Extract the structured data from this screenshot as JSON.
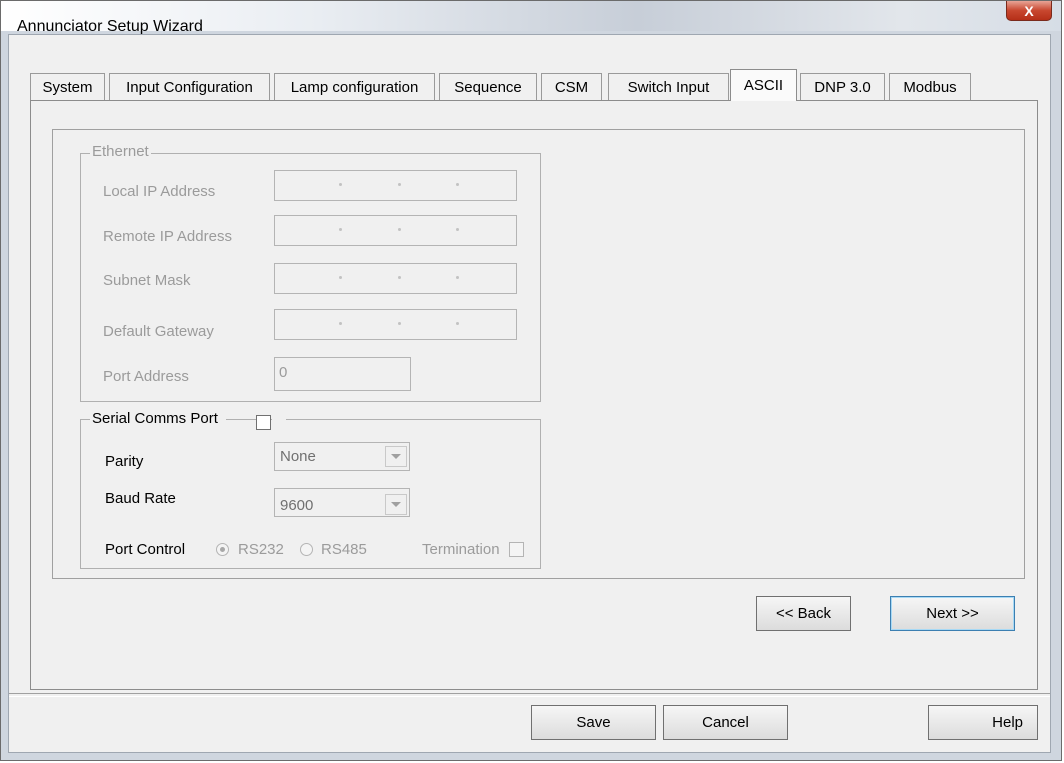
{
  "window": {
    "title": "Annunciator Setup Wizard",
    "close_glyph": "X"
  },
  "tabs": [
    {
      "label": "System"
    },
    {
      "label": "Input Configuration"
    },
    {
      "label": "Lamp configuration"
    },
    {
      "label": "Sequence"
    },
    {
      "label": "CSM"
    },
    {
      "label": "Switch Input"
    },
    {
      "label": "ASCII",
      "active": true
    },
    {
      "label": "DNP 3.0"
    },
    {
      "label": "Modbus"
    }
  ],
  "ethernet": {
    "legend": "Ethernet",
    "local_ip_label": "Local IP Address",
    "remote_ip_label": "Remote IP Address",
    "subnet_label": "Subnet Mask",
    "gateway_label": "Default Gateway",
    "port_address_label": "Port Address",
    "port_address_value": "0"
  },
  "serial": {
    "legend": "Serial Comms Port",
    "enabled": false,
    "parity_label": "Parity",
    "parity_value": "None",
    "baud_label": "Baud Rate",
    "baud_value": "9600",
    "port_control_label": "Port Control",
    "rs232_label": "RS232",
    "rs485_label": "RS485",
    "selected_port": "RS232",
    "termination_label": "Termination"
  },
  "nav": {
    "back_label": "<< Back",
    "next_label": "Next >>"
  },
  "footer": {
    "save_label": "Save",
    "cancel_label": "Cancel",
    "help_label": "Help"
  },
  "icons": {
    "dropdown": "chevron-down-icon",
    "close": "close-icon"
  }
}
